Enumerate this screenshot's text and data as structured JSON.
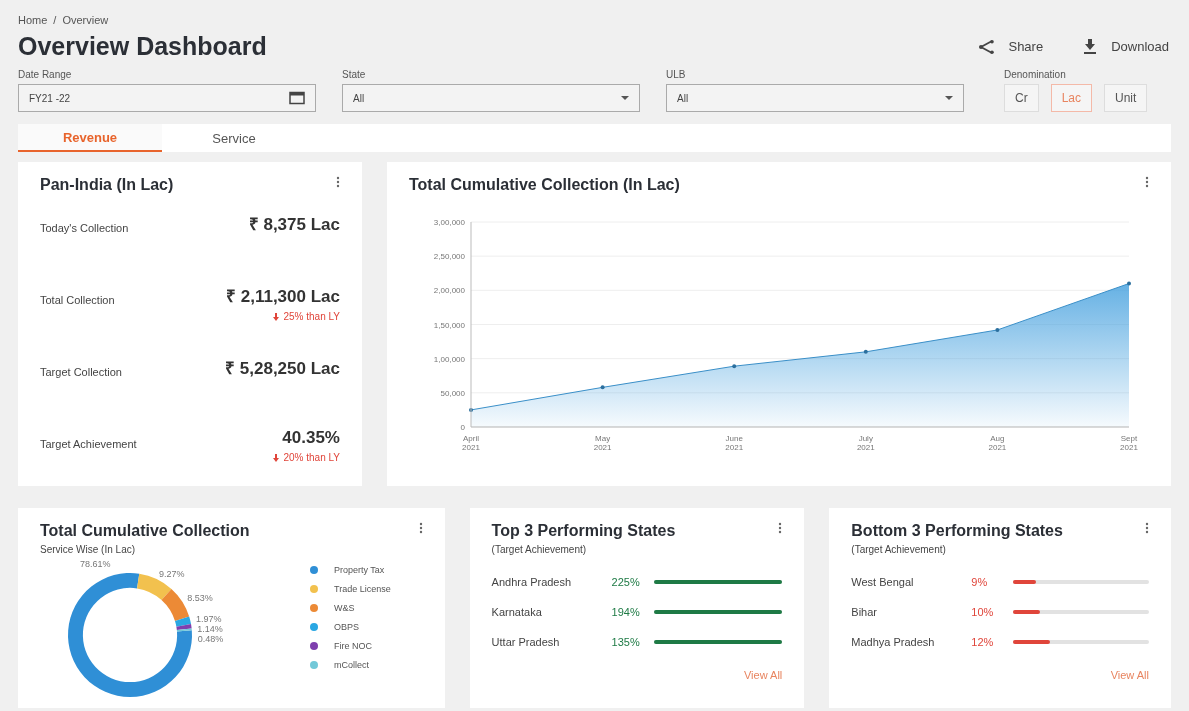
{
  "breadcrumb": [
    "Home",
    "/",
    "Overview"
  ],
  "title": "Overview Dashboard",
  "actions": [
    {
      "kind": "share",
      "label": "Share"
    },
    {
      "kind": "download",
      "label": "Download"
    }
  ],
  "filters": [
    {
      "label": "Date Range",
      "value": "FY21 -22",
      "kind": "date"
    },
    {
      "label": "State",
      "value": "All",
      "kind": "select"
    },
    {
      "label": "ULB",
      "value": "All",
      "kind": "select"
    }
  ],
  "denomination": {
    "label": "Denomination",
    "options": [
      {
        "label": "Cr",
        "selected": false
      },
      {
        "label": "Lac",
        "selected": true
      },
      {
        "label": "Unit",
        "selected": false
      }
    ]
  },
  "tabs": [
    {
      "label": "Revenue",
      "selected": true
    },
    {
      "label": "Service",
      "selected": false
    }
  ],
  "summary": {
    "title": "Pan-India (In Lac)",
    "rows": [
      {
        "label": "Today's Collection",
        "value": "₹ 8,375 Lac"
      },
      {
        "label": "Total Collection",
        "value": "₹ 2,11,300 Lac",
        "change": "25% than LY"
      },
      {
        "label": "Target Collection",
        "value": "₹ 5,28,250 Lac"
      },
      {
        "label": "Target Achievement",
        "value": "40.35%",
        "change": "20% than LY"
      }
    ]
  },
  "trend": {
    "title": "Total Cumulative Collection (In Lac)",
    "chart_data": {
      "type": "area",
      "categories": [
        "April 2021",
        "May 2021",
        "June 2021",
        "July 2021",
        "Aug 2021",
        "Sept 2021"
      ],
      "grid": true,
      "series": [
        {
          "color": "#4aa3df",
          "values": [
            25000,
            58000,
            89000,
            110000,
            142000,
            210000
          ]
        }
      ],
      "ylim": [
        0,
        300000
      ],
      "yticks": [
        {
          "value": 0,
          "label": "0"
        },
        {
          "value": 50000,
          "label": "50,000"
        },
        {
          "value": 100000,
          "label": "1,00,000"
        },
        {
          "value": 150000,
          "label": "1,50,000"
        },
        {
          "value": 200000,
          "label": "2,00,000"
        },
        {
          "value": 250000,
          "label": "2,50,000"
        },
        {
          "value": 300000,
          "label": "3,00,000"
        }
      ]
    }
  },
  "services": {
    "title": "Total Cumulative Collection",
    "subtitle": "Service Wise (In Lac)",
    "chart_data": {
      "type": "donut",
      "categories": [
        "Property Tax",
        "Trade License",
        "W&S",
        "OBPS",
        "Fire NOC",
        "mCollect"
      ],
      "colors": [
        "#2f8fd6",
        "#f2c14e",
        "#ec8a36",
        "#2aa7e3",
        "#7e3fae",
        "#72c8d8"
      ],
      "values": [
        78.61,
        9.27,
        8.53,
        1.97,
        1.14,
        0.48
      ],
      "legend": "right",
      "value_labels": [
        "78.61%",
        "9.27%",
        "8.53%",
        "1.97%",
        "1.14%",
        "0.48%"
      ]
    }
  },
  "rankings": [
    {
      "title": "Top 3 Performing States",
      "subtitle": "(Target Achievement)",
      "color": "#1e7a45",
      "link": "View All",
      "rows": [
        {
          "name": "Andhra Pradesh",
          "value": "225%",
          "level": 1
        },
        {
          "name": "Karnataka",
          "value": "194%",
          "level": 1
        },
        {
          "name": "Uttar Pradesh",
          "value": "135%",
          "level": 1
        }
      ]
    },
    {
      "title": "Bottom 3 Performing States",
      "subtitle": "(Target Achievement)",
      "color": "#e0453a",
      "link": "View All",
      "rows": [
        {
          "name": "West Bengal",
          "value": "9%",
          "level": 0.17
        },
        {
          "name": "Bihar",
          "value": "10%",
          "level": 0.2
        },
        {
          "name": "Madhya Pradesh",
          "value": "12%",
          "level": 0.27
        }
      ]
    }
  ]
}
